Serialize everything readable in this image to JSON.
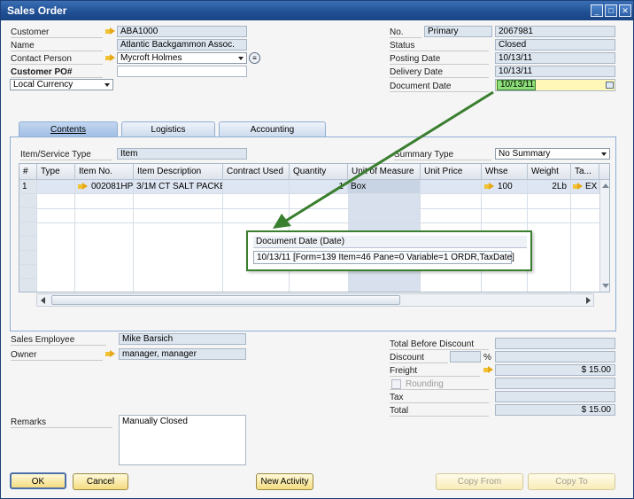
{
  "window": {
    "title": "Sales Order",
    "controls": [
      "_",
      "□",
      "✕"
    ]
  },
  "header_left": {
    "customer": {
      "label": "Customer",
      "value": "ABA1000"
    },
    "name": {
      "label": "Name",
      "value": "Atlantic Backgammon Assoc."
    },
    "contact_person": {
      "label": "Contact Person",
      "value": "Mycroft Holmes"
    },
    "customer_po": {
      "label": "Customer PO#",
      "value": ""
    },
    "currency": {
      "value": "Local Currency"
    }
  },
  "header_right": {
    "no": {
      "label": "No.",
      "series": "Primary",
      "value": "2067981"
    },
    "status": {
      "label": "Status",
      "value": "Closed"
    },
    "posting_date": {
      "label": "Posting Date",
      "value": "10/13/11"
    },
    "delivery_date": {
      "label": "Delivery Date",
      "value": "10/13/11"
    },
    "document_date": {
      "label": "Document Date",
      "value": "10/13/11"
    }
  },
  "tabs": [
    {
      "label": "Contents",
      "active": true
    },
    {
      "label": "Logistics",
      "active": false
    },
    {
      "label": "Accounting",
      "active": false
    }
  ],
  "contents": {
    "item_service_type": {
      "label": "Item/Service Type",
      "value": "Item"
    },
    "summary_type": {
      "label": "Summary Type",
      "value": "No Summary"
    },
    "columns": [
      "#",
      "Type",
      "Item No.",
      "Item Description",
      "Contract Used",
      "Quantity",
      "Unit of Measure",
      "Unit Price",
      "Whse",
      "Weight",
      "Ta..."
    ],
    "rows": [
      {
        "num": "1",
        "type": "",
        "item_no": "002081HP",
        "description": "3/1M CT SALT PACKE",
        "contract": "",
        "quantity": "1",
        "uom": "Box",
        "unit_price": "",
        "whse": "100",
        "weight": "2Lb",
        "tax": "EX"
      }
    ]
  },
  "tooltip": {
    "title": "Document Date (Date)",
    "info": "10/13/11 [Form=139 Item=46 Pane=0 Variable=1 ORDR,TaxDate]"
  },
  "footer_left": {
    "sales_employee": {
      "label": "Sales Employee",
      "value": "Mike Barsich"
    },
    "owner": {
      "label": "Owner",
      "value": "manager, manager"
    },
    "remarks": {
      "label": "Remarks",
      "value": "Manually Closed"
    }
  },
  "totals": {
    "total_before_discount": {
      "label": "Total Before Discount",
      "value": ""
    },
    "discount": {
      "label": "Discount",
      "percent_sign": "%",
      "value": ""
    },
    "freight": {
      "label": "Freight",
      "value": "$ 15.00"
    },
    "rounding": {
      "label": "Rounding",
      "value": ""
    },
    "tax": {
      "label": "Tax",
      "value": ""
    },
    "total": {
      "label": "Total",
      "value": "$ 15.00"
    }
  },
  "buttons": {
    "ok": "OK",
    "cancel": "Cancel",
    "new_activity": "New Activity",
    "copy_from": "Copy From",
    "copy_to": "Copy To"
  },
  "colors": {
    "titlebar": "#1f4f93",
    "annotation": "#3a7e2f",
    "highlight": "#8ee07a"
  }
}
